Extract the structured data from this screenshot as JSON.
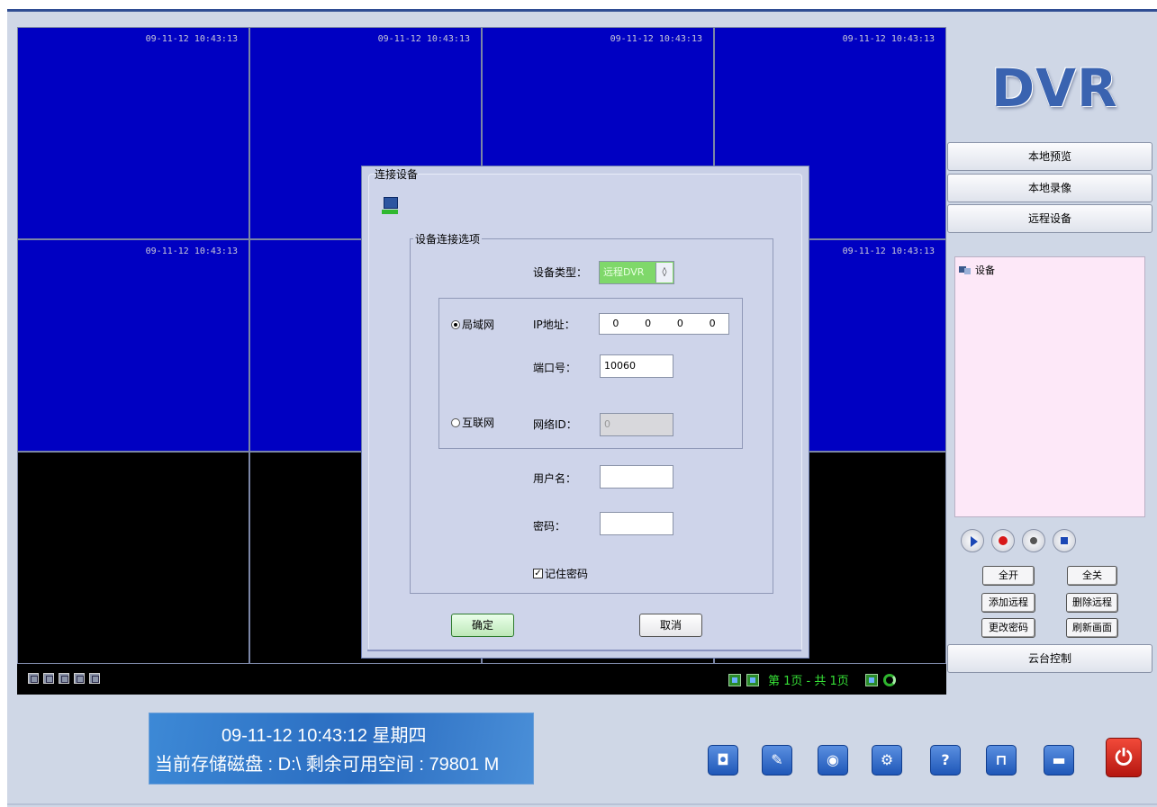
{
  "video": {
    "timestamp": "09-11-12 10:43:13",
    "pager_text": "第 1页 - 共 1页"
  },
  "logo": "DVR",
  "nav": {
    "local_preview": "本地预览",
    "local_record": "本地录像",
    "remote_device": "远程设备",
    "ptz": "云台控制"
  },
  "tree": {
    "root": "设备"
  },
  "buttons": {
    "all_on": "全开",
    "all_off": "全关",
    "add_remote": "添加远程",
    "delete_remote": "删除远程",
    "change_password": "更改密码",
    "refresh_view": "刷新画面"
  },
  "status": {
    "datetime": "09-11-12   10:43:12    星期四",
    "disk": "当前存储磁盘 : D:\\    剩余可用空间 : 79801 M"
  },
  "dialog": {
    "title": "连接设备",
    "group_title": "设备连接选项",
    "device_type_label": "设备类型：",
    "device_type_value": "远程DVR",
    "lan_label": "局域网",
    "wan_label": "互联网",
    "ip_label": "IP地址：",
    "ip": [
      "0",
      "0",
      "0",
      "0"
    ],
    "port_label": "端口号：",
    "port_value": "10060",
    "netid_label": "网络ID：",
    "netid_value": "0",
    "username_label": "用户名：",
    "username_value": "",
    "password_label": "密码：",
    "password_value": "",
    "remember_label": "记住密码",
    "ok": "确定",
    "cancel": "取消"
  }
}
